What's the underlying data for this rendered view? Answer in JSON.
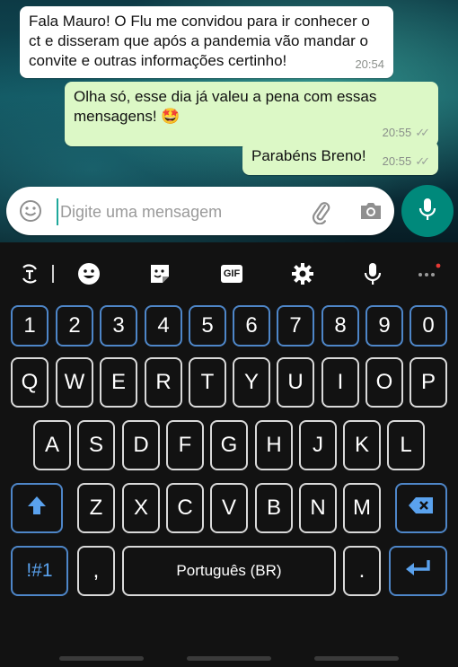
{
  "chat": {
    "messages": [
      {
        "text": "Fala Mauro! O Flu me convidou para ir conhecer o ct e disseram que após a pandemia vão mandar o convite e outras informações certinho!",
        "time": "20:54",
        "direction": "incoming"
      },
      {
        "text": "Olha só, esse dia já valeu a pena com essas mensagens! 🤩",
        "time": "20:55",
        "direction": "outgoing",
        "status": "read"
      },
      {
        "text": "Parabéns Breno!",
        "time": "20:55",
        "direction": "outgoing",
        "status": "read"
      }
    ]
  },
  "composer": {
    "placeholder": "Digite uma mensagem",
    "icons": [
      "emoji-icon",
      "attach-icon",
      "camera-icon",
      "mic-icon"
    ]
  },
  "keyboard": {
    "toolbar": [
      "text-edit-icon",
      "emoji-icon",
      "sticker-icon",
      "gif-icon",
      "settings-icon",
      "voice-icon",
      "more-icon"
    ],
    "toolbar_gif_label": "GIF",
    "number_row": [
      "1",
      "2",
      "3",
      "4",
      "5",
      "6",
      "7",
      "8",
      "9",
      "0"
    ],
    "row1": [
      "Q",
      "W",
      "E",
      "R",
      "T",
      "Y",
      "U",
      "I",
      "O",
      "P"
    ],
    "row2": [
      "A",
      "S",
      "D",
      "F",
      "G",
      "H",
      "J",
      "K",
      "L"
    ],
    "row3": [
      "Z",
      "X",
      "C",
      "V",
      "B",
      "N",
      "M"
    ],
    "symbols_label": "!#1",
    "comma_label": ",",
    "space_label": "Português (BR)",
    "period_label": "."
  },
  "colors": {
    "accent": "#00897b",
    "incoming_bubble": "#ffffff",
    "outgoing_bubble": "#dcf8c6",
    "key_function_border": "#4e86c8",
    "keyboard_bg": "#121212"
  }
}
